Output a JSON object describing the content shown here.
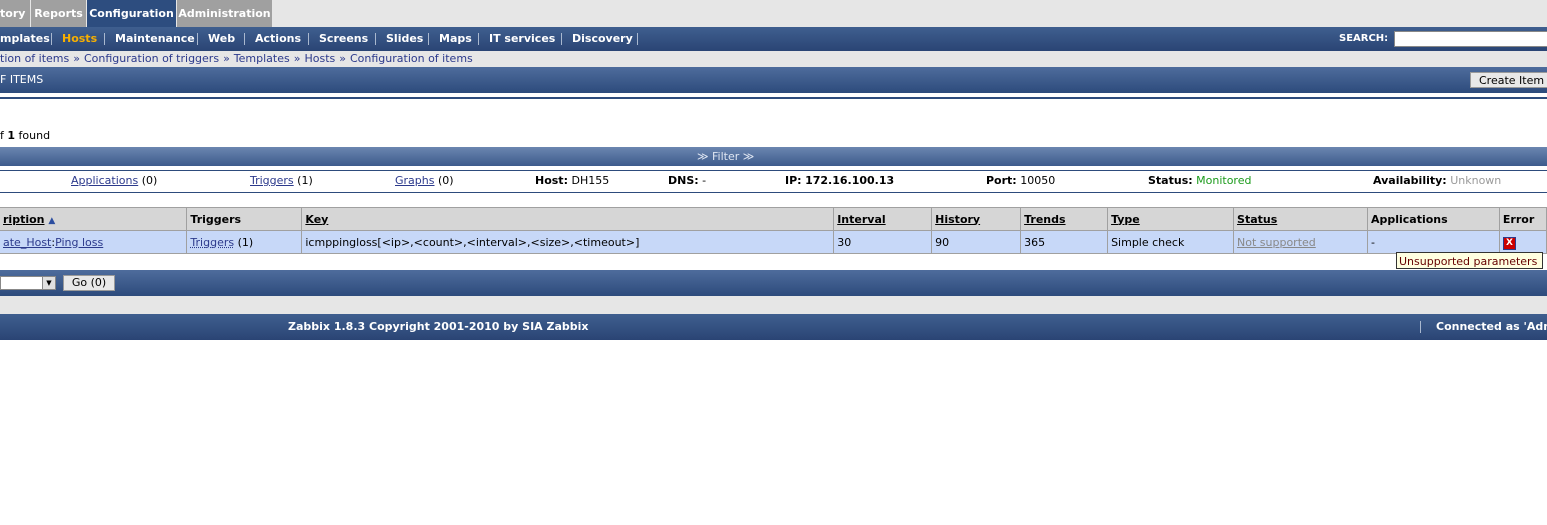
{
  "main_menu": [
    "tory",
    "Reports",
    "Configuration",
    "Administration"
  ],
  "sub_menu": [
    "mplates",
    "Hosts",
    "Maintenance",
    "Web",
    "Actions",
    "Screens",
    "Slides",
    "Maps",
    "IT services",
    "Discovery"
  ],
  "search": {
    "label": "SEARCH:",
    "value": ""
  },
  "breadcrumb": [
    "tion of items",
    "Configuration of triggers",
    "Templates",
    "Hosts",
    "Configuration of items"
  ],
  "breadcrumb_separator": "»",
  "page_title": "F ITEMS",
  "create_item_label": "Create Item",
  "found": {
    "prefix": "f",
    "count": "1",
    "suffix": "found"
  },
  "filter_label": "≫ Filter ≫",
  "host_info": {
    "applications_link": "Applications",
    "applications_count": "(0)",
    "triggers_link": "Triggers",
    "triggers_count": "(1)",
    "graphs_link": "Graphs",
    "graphs_count": "(0)",
    "host_label": "Host:",
    "host_value": "DH155",
    "dns_label": "DNS:",
    "dns_value": "-",
    "ip_label": "IP:",
    "ip_value": "172.16.100.13",
    "port_label": "Port:",
    "port_value": "10050",
    "status_label": "Status:",
    "status_value": "Monitored",
    "availability_label": "Availability:",
    "availability_value": "Unknown"
  },
  "table": {
    "headers": [
      "ription",
      "Triggers",
      "Key",
      "Interval",
      "History",
      "Trends",
      "Type",
      "Status",
      "Applications",
      "Error"
    ],
    "row": {
      "desc_template": "ate_Host",
      "desc_sep": ":",
      "desc_name": "Ping loss",
      "triggers_link": "Triggers",
      "triggers_count": "(1)",
      "key": "icmppingloss[<ip>,<count>,<interval>,<size>,<timeout>]",
      "interval": "30",
      "history": "90",
      "trends": "365",
      "type": "Simple check",
      "status": "Not supported",
      "applications": "-",
      "error_icon": "X"
    }
  },
  "tooltip": "Unsupported parameters",
  "go_button": "Go (0)",
  "footer": {
    "copyright": "Zabbix 1.8.3 Copyright 2001-2010 by SIA Zabbix",
    "connected": "Connected as 'Admi"
  },
  "colors": {
    "nav_blue": "#2d4b7c",
    "active_menu": "#f8b000",
    "row_highlight": "#c7d8f8",
    "monitored": "#1a9a1a"
  }
}
